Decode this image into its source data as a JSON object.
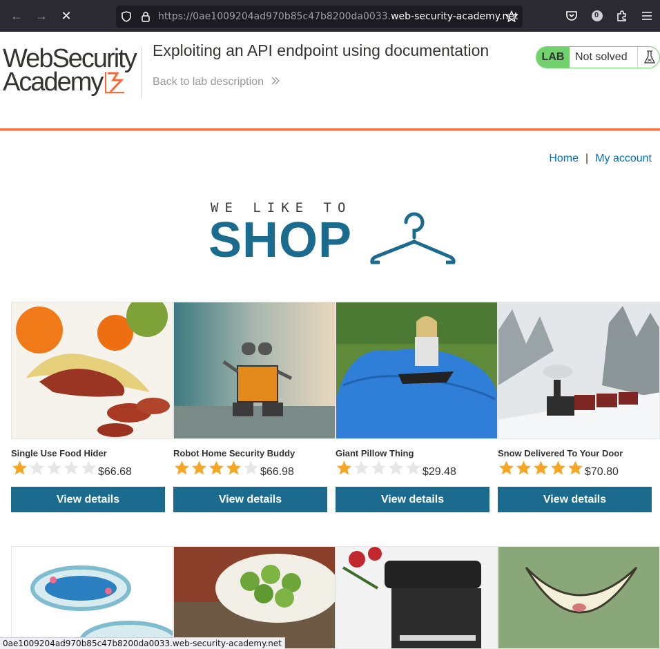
{
  "browser": {
    "url_prefix": "https://0ae1009204ad970b85c47b8200da0033.",
    "url_host": "web-security-academy.net",
    "extension_badge": "0",
    "status_url": "0ae1009204ad970b85c47b8200da0033.web-security-academy.net"
  },
  "lab": {
    "logo_line1": "WebSecurity",
    "logo_line2": "Academy",
    "title": "Exploiting an API endpoint using documentation",
    "back_link": "Back to lab description",
    "badge": "LAB",
    "status": "Not solved"
  },
  "site_nav": {
    "home": "Home",
    "separator": "|",
    "account": "My account"
  },
  "shop_logo": {
    "small": "WE LIKE TO",
    "big": "SHOP"
  },
  "products": [
    {
      "name": "Single Use Food Hider",
      "rating": 1,
      "price": "$66.68",
      "button": "View details"
    },
    {
      "name": "Robot Home Security Buddy",
      "rating": 4,
      "price": "$66.98",
      "button": "View details"
    },
    {
      "name": "Giant Pillow Thing",
      "rating": 1,
      "price": "$29.48",
      "button": "View details"
    },
    {
      "name": "Snow Delivered To Your Door",
      "rating": 5,
      "price": "$70.80",
      "button": "View details"
    }
  ],
  "colors": {
    "accent": "#ff6633",
    "button": "#1a6b8e",
    "star_filled": "#f5a623",
    "star_empty": "#e6e6e6",
    "lab_green": "#70d16d"
  }
}
